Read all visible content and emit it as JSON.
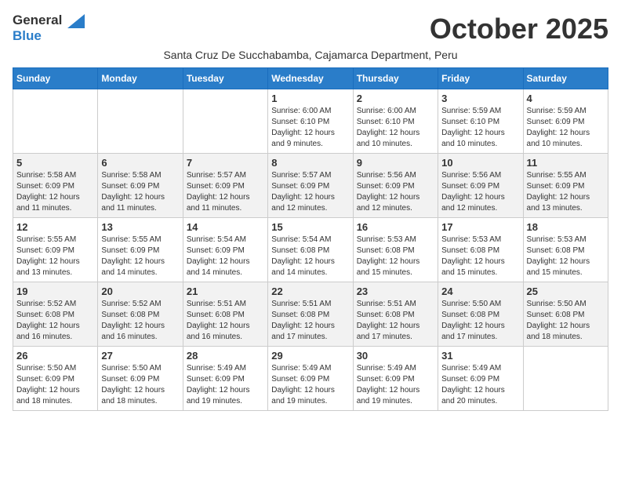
{
  "logo": {
    "line1": "General",
    "line2": "Blue"
  },
  "title": "October 2025",
  "subtitle": "Santa Cruz De Succhabamba, Cajamarca Department, Peru",
  "weekdays": [
    "Sunday",
    "Monday",
    "Tuesday",
    "Wednesday",
    "Thursday",
    "Friday",
    "Saturday"
  ],
  "weeks": [
    [
      {
        "day": "",
        "info": ""
      },
      {
        "day": "",
        "info": ""
      },
      {
        "day": "",
        "info": ""
      },
      {
        "day": "1",
        "info": "Sunrise: 6:00 AM\nSunset: 6:10 PM\nDaylight: 12 hours\nand 9 minutes."
      },
      {
        "day": "2",
        "info": "Sunrise: 6:00 AM\nSunset: 6:10 PM\nDaylight: 12 hours\nand 10 minutes."
      },
      {
        "day": "3",
        "info": "Sunrise: 5:59 AM\nSunset: 6:10 PM\nDaylight: 12 hours\nand 10 minutes."
      },
      {
        "day": "4",
        "info": "Sunrise: 5:59 AM\nSunset: 6:09 PM\nDaylight: 12 hours\nand 10 minutes."
      }
    ],
    [
      {
        "day": "5",
        "info": "Sunrise: 5:58 AM\nSunset: 6:09 PM\nDaylight: 12 hours\nand 11 minutes."
      },
      {
        "day": "6",
        "info": "Sunrise: 5:58 AM\nSunset: 6:09 PM\nDaylight: 12 hours\nand 11 minutes."
      },
      {
        "day": "7",
        "info": "Sunrise: 5:57 AM\nSunset: 6:09 PM\nDaylight: 12 hours\nand 11 minutes."
      },
      {
        "day": "8",
        "info": "Sunrise: 5:57 AM\nSunset: 6:09 PM\nDaylight: 12 hours\nand 12 minutes."
      },
      {
        "day": "9",
        "info": "Sunrise: 5:56 AM\nSunset: 6:09 PM\nDaylight: 12 hours\nand 12 minutes."
      },
      {
        "day": "10",
        "info": "Sunrise: 5:56 AM\nSunset: 6:09 PM\nDaylight: 12 hours\nand 12 minutes."
      },
      {
        "day": "11",
        "info": "Sunrise: 5:55 AM\nSunset: 6:09 PM\nDaylight: 12 hours\nand 13 minutes."
      }
    ],
    [
      {
        "day": "12",
        "info": "Sunrise: 5:55 AM\nSunset: 6:09 PM\nDaylight: 12 hours\nand 13 minutes."
      },
      {
        "day": "13",
        "info": "Sunrise: 5:55 AM\nSunset: 6:09 PM\nDaylight: 12 hours\nand 14 minutes."
      },
      {
        "day": "14",
        "info": "Sunrise: 5:54 AM\nSunset: 6:09 PM\nDaylight: 12 hours\nand 14 minutes."
      },
      {
        "day": "15",
        "info": "Sunrise: 5:54 AM\nSunset: 6:08 PM\nDaylight: 12 hours\nand 14 minutes."
      },
      {
        "day": "16",
        "info": "Sunrise: 5:53 AM\nSunset: 6:08 PM\nDaylight: 12 hours\nand 15 minutes."
      },
      {
        "day": "17",
        "info": "Sunrise: 5:53 AM\nSunset: 6:08 PM\nDaylight: 12 hours\nand 15 minutes."
      },
      {
        "day": "18",
        "info": "Sunrise: 5:53 AM\nSunset: 6:08 PM\nDaylight: 12 hours\nand 15 minutes."
      }
    ],
    [
      {
        "day": "19",
        "info": "Sunrise: 5:52 AM\nSunset: 6:08 PM\nDaylight: 12 hours\nand 16 minutes."
      },
      {
        "day": "20",
        "info": "Sunrise: 5:52 AM\nSunset: 6:08 PM\nDaylight: 12 hours\nand 16 minutes."
      },
      {
        "day": "21",
        "info": "Sunrise: 5:51 AM\nSunset: 6:08 PM\nDaylight: 12 hours\nand 16 minutes."
      },
      {
        "day": "22",
        "info": "Sunrise: 5:51 AM\nSunset: 6:08 PM\nDaylight: 12 hours\nand 17 minutes."
      },
      {
        "day": "23",
        "info": "Sunrise: 5:51 AM\nSunset: 6:08 PM\nDaylight: 12 hours\nand 17 minutes."
      },
      {
        "day": "24",
        "info": "Sunrise: 5:50 AM\nSunset: 6:08 PM\nDaylight: 12 hours\nand 17 minutes."
      },
      {
        "day": "25",
        "info": "Sunrise: 5:50 AM\nSunset: 6:08 PM\nDaylight: 12 hours\nand 18 minutes."
      }
    ],
    [
      {
        "day": "26",
        "info": "Sunrise: 5:50 AM\nSunset: 6:09 PM\nDaylight: 12 hours\nand 18 minutes."
      },
      {
        "day": "27",
        "info": "Sunrise: 5:50 AM\nSunset: 6:09 PM\nDaylight: 12 hours\nand 18 minutes."
      },
      {
        "day": "28",
        "info": "Sunrise: 5:49 AM\nSunset: 6:09 PM\nDaylight: 12 hours\nand 19 minutes."
      },
      {
        "day": "29",
        "info": "Sunrise: 5:49 AM\nSunset: 6:09 PM\nDaylight: 12 hours\nand 19 minutes."
      },
      {
        "day": "30",
        "info": "Sunrise: 5:49 AM\nSunset: 6:09 PM\nDaylight: 12 hours\nand 19 minutes."
      },
      {
        "day": "31",
        "info": "Sunrise: 5:49 AM\nSunset: 6:09 PM\nDaylight: 12 hours\nand 20 minutes."
      },
      {
        "day": "",
        "info": ""
      }
    ]
  ]
}
